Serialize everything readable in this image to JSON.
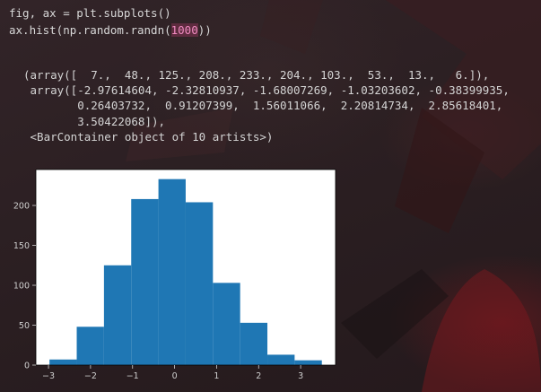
{
  "code": {
    "line1": "fig, ax = plt.subplots()",
    "line2_prefix": "ax.hist(np.random.randn(",
    "line2_arg": "1000",
    "line2_suffix": "))"
  },
  "output": {
    "line1": "(array([  7.,  48., 125., 208., 233., 204., 103.,  53.,  13.,   6.]),",
    "line2": " array([-2.97614604, -2.32810937, -1.68007269, -1.03203602, -0.38399935,",
    "line3": "        0.26403732,  0.91207399,  1.56011066,  2.20814734,  2.85618401,",
    "line4": "        3.50422068]),",
    "line5": " <BarContainer object of 10 artists>)"
  },
  "chart_data": {
    "type": "bar",
    "bin_edges": [
      -2.97614604,
      -2.32810937,
      -1.68007269,
      -1.03203602,
      -0.38399935,
      0.26403732,
      0.91207399,
      1.56011066,
      2.20814734,
      2.85618401,
      3.50422068
    ],
    "counts": [
      7,
      48,
      125,
      208,
      233,
      204,
      103,
      53,
      13,
      6
    ],
    "xlim": [
      -3.3,
      3.83
    ],
    "ylim": [
      0,
      245
    ],
    "xticks": [
      -3,
      -2,
      -1,
      0,
      1,
      2,
      3
    ],
    "yticks": [
      0,
      50,
      100,
      150,
      200
    ],
    "bar_color": "#1f77b4",
    "title": "",
    "xlabel": "",
    "ylabel": ""
  }
}
